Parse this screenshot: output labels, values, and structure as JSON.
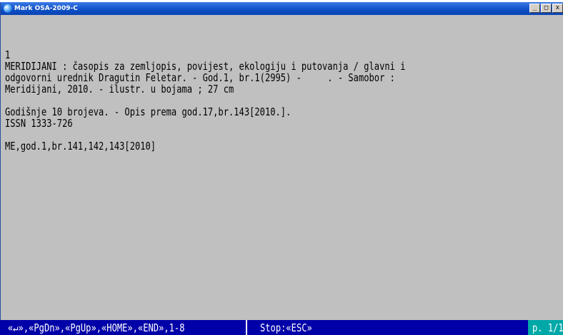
{
  "window": {
    "title": "Mark OSA-2009-C",
    "controls": {
      "minimize": "_",
      "maximize": "□",
      "close": "x"
    }
  },
  "terminal": {
    "lines": [
      "",
      "",
      "",
      "1",
      "MERIDIJANI : časopis za zemljopis, povijest, ekologiju i putovanja / glavni i",
      "odgovorni urednik Dragutin Feletar. - God.1, br.1(2995) -     . - Samobor :",
      "Meridijani, 2010. - ilustr. u bojama ; 27 cm",
      "",
      "Godišnje 10 brojeva. - Opis prema god.17,br.143[2010.].",
      "ISSN 1333-726",
      "",
      "ME,god.1,br.141,142,143[2010]"
    ]
  },
  "statusbar": {
    "keys": "«↵»,«PgDn»,«PgUp»,«HOME»,«END»,1-8",
    "stop": "Stop:«ESC»",
    "page": "p. 1/1"
  },
  "colors": {
    "terminal_bg": "#c0c0c0",
    "statusbar_bg": "#0000a8",
    "page_indicator_bg": "#00a8a8",
    "titlebar": "#0a4ac0"
  }
}
